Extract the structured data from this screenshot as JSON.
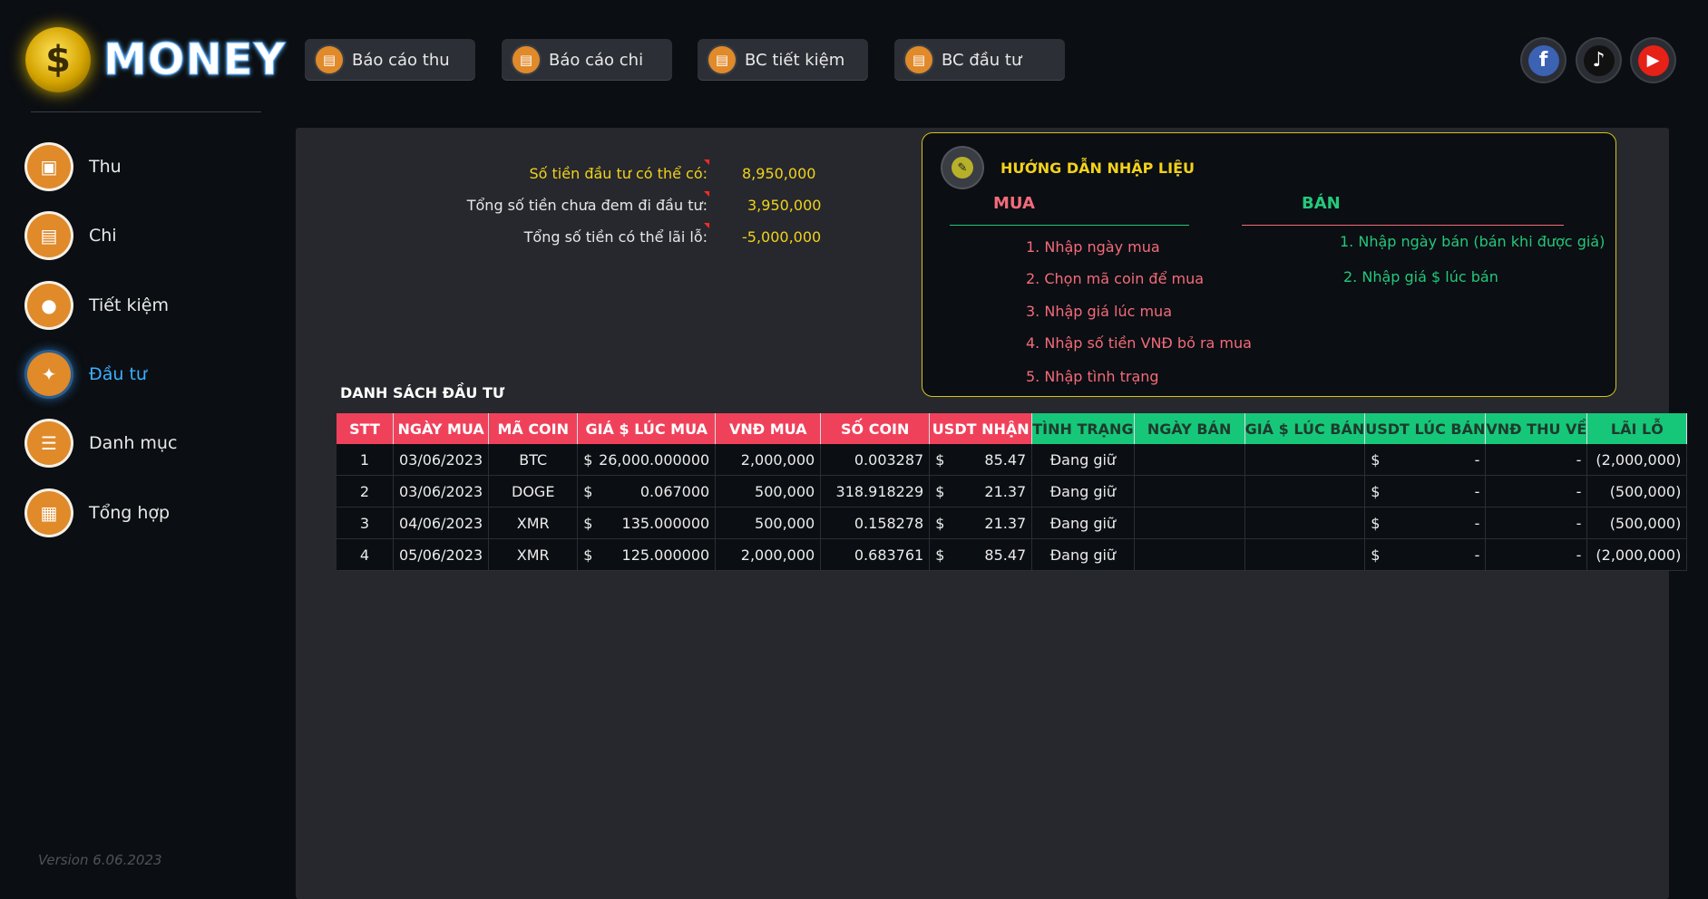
{
  "app": {
    "logo_symbol": "$",
    "logo_text": "MONEY",
    "version": "Version 6.06.2023"
  },
  "top_buttons": [
    {
      "label": "Báo cáo thu",
      "icon": "report-icon"
    },
    {
      "label": "Báo cáo chi",
      "icon": "report-icon"
    },
    {
      "label": "BC tiết kiệm",
      "icon": "report-icon"
    },
    {
      "label": "BC đầu tư",
      "icon": "report-icon"
    }
  ],
  "social": [
    {
      "name": "facebook",
      "glyph": "f",
      "color": "#3b62b3"
    },
    {
      "name": "tiktok",
      "glyph": "♪",
      "color": "#111111"
    },
    {
      "name": "youtube",
      "glyph": "▶",
      "color": "#e62117"
    }
  ],
  "sidebar": {
    "items": [
      {
        "label": "Thu",
        "icon": "income-icon",
        "glyph": "▣",
        "active": false
      },
      {
        "label": "Chi",
        "icon": "expense-icon",
        "glyph": "▤",
        "active": false
      },
      {
        "label": "Tiết kiệm",
        "icon": "piggy-bank-icon",
        "glyph": "●",
        "active": false
      },
      {
        "label": "Đầu tư",
        "icon": "investment-icon",
        "glyph": "✦",
        "active": true
      },
      {
        "label": "Danh mục",
        "icon": "clipboard-icon",
        "glyph": "☰",
        "active": false
      },
      {
        "label": "Tổng hợp",
        "icon": "summary-icon",
        "glyph": "▦",
        "active": false
      }
    ]
  },
  "summary": [
    {
      "label": "Số tiền đầu tư có thể có:",
      "value": "8,950,000",
      "color": "#f2d21b"
    },
    {
      "label": "Tổng số tiền chưa đem đi đầu tư:",
      "value": "3,950,000",
      "color": "#e8e8e8"
    },
    {
      "label": "Tổng số tiền có thể lãi lỗ:",
      "value": "-5,000,000",
      "color": "#e8e8e8"
    }
  ],
  "guide": {
    "title": "HƯỚNG DẪN NHẬP LIỆU",
    "buy_title": "MUA",
    "sell_title": "BÁN",
    "buy_steps": [
      "1. Nhập ngày mua",
      "2. Chọn mã coin để mua",
      "3. Nhập giá lúc mua",
      "4. Nhập số tiền VNĐ bỏ ra mua",
      "5. Nhập tình trạng"
    ],
    "sell_steps": [
      "1. Nhập ngày bán (bán khi được giá)",
      "2. Nhập giá $ lúc bán"
    ]
  },
  "list_title": "DANH SÁCH ĐẦU TƯ",
  "table": {
    "headers_red": [
      "STT",
      "NGÀY MUA",
      "MÃ COIN",
      "GIÁ $ LÚC MUA",
      "VNĐ MUA",
      "SỐ COIN",
      "USDT NHẬN"
    ],
    "headers_green": [
      "TÌNH TRẠNG",
      "NGÀY BÁN",
      "GIÁ $ LÚC BÁN",
      "USDT LÚC BÁN",
      "VNĐ THU VỀ",
      "LÃI LỖ"
    ],
    "rows": [
      {
        "stt": "1",
        "buy_date": "03/06/2023",
        "coin": "BTC",
        "price_cur": "$",
        "price": "26,000.000000",
        "vnd": "2,000,000",
        "qty": "0.003287",
        "usdt_cur": "$",
        "usdt": "85.47",
        "status": "Đang giữ",
        "sell_date": "",
        "sell_price": "",
        "usdt_sell_cur": "$",
        "usdt_sell": "-",
        "vnd_back": "-",
        "pnl": "(2,000,000)"
      },
      {
        "stt": "2",
        "buy_date": "03/06/2023",
        "coin": "DOGE",
        "price_cur": "$",
        "price": "0.067000",
        "vnd": "500,000",
        "qty": "318.918229",
        "usdt_cur": "$",
        "usdt": "21.37",
        "status": "Đang giữ",
        "sell_date": "",
        "sell_price": "",
        "usdt_sell_cur": "$",
        "usdt_sell": "-",
        "vnd_back": "-",
        "pnl": "(500,000)"
      },
      {
        "stt": "3",
        "buy_date": "04/06/2023",
        "coin": "XMR",
        "price_cur": "$",
        "price": "135.000000",
        "vnd": "500,000",
        "qty": "0.158278",
        "usdt_cur": "$",
        "usdt": "21.37",
        "status": "Đang giữ",
        "sell_date": "",
        "sell_price": "",
        "usdt_sell_cur": "$",
        "usdt_sell": "-",
        "vnd_back": "-",
        "pnl": "(500,000)"
      },
      {
        "stt": "4",
        "buy_date": "05/06/2023",
        "coin": "XMR",
        "price_cur": "$",
        "price": "125.000000",
        "vnd": "2,000,000",
        "qty": "0.683761",
        "usdt_cur": "$",
        "usdt": "85.47",
        "status": "Đang giữ",
        "sell_date": "",
        "sell_price": "",
        "usdt_sell_cur": "$",
        "usdt_sell": "-",
        "vnd_back": "-",
        "pnl": "(2,000,000)"
      }
    ]
  }
}
